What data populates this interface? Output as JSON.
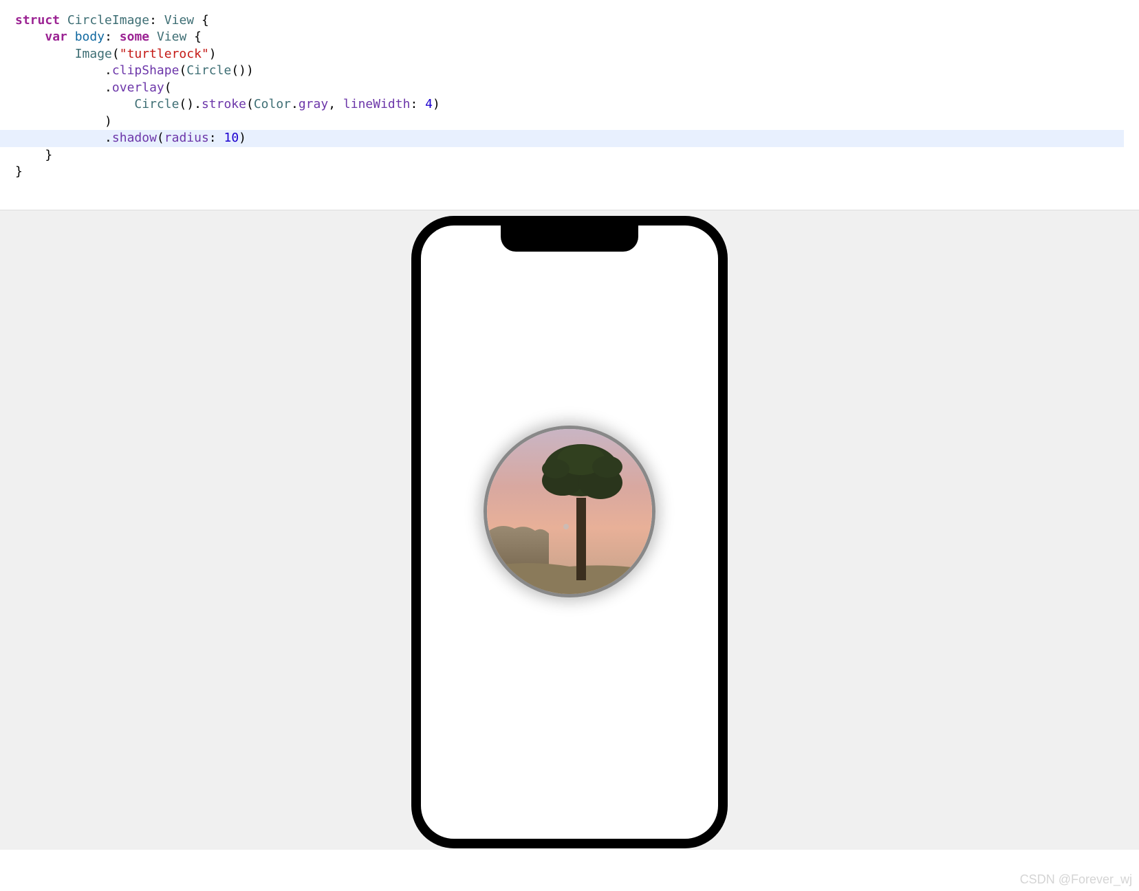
{
  "code": {
    "l1": {
      "kw": "struct",
      "name": "CircleImage",
      "colon": ": ",
      "proto": "View",
      "brace": " {"
    },
    "l2": {
      "indent": "    ",
      "kw": "var",
      "name": "body",
      "colon": ": ",
      "some": "some",
      "proto": "View",
      "brace": " {"
    },
    "l3": {
      "indent": "        ",
      "type": "Image",
      "open": "(",
      "str": "\"turtlerock\"",
      "close": ")"
    },
    "l4": {
      "indent": "            .",
      "method": "clipShape",
      "open": "(",
      "type": "Circle",
      "call": "()",
      "close": ")"
    },
    "l5": {
      "indent": "            .",
      "method": "overlay",
      "open": "("
    },
    "l6": {
      "indent": "                ",
      "type": "Circle",
      "call": "().",
      "method": "stroke",
      "open": "(",
      "type2": "Color",
      "dot": ".",
      "prop": "gray",
      "comma": ", ",
      "param": "lineWidth",
      "colon": ": ",
      "num": "4",
      "close": ")"
    },
    "l7": {
      "indent": "            ",
      "close": ")"
    },
    "l8": {
      "indent": "            .",
      "method": "shadow",
      "open": "(",
      "param": "radius",
      "colon": ": ",
      "num": "10",
      "close": ")"
    },
    "l9": {
      "indent": "    ",
      "close": "}"
    },
    "l10": {
      "close": "}"
    }
  },
  "watermark": "CSDN @Forever_wj"
}
